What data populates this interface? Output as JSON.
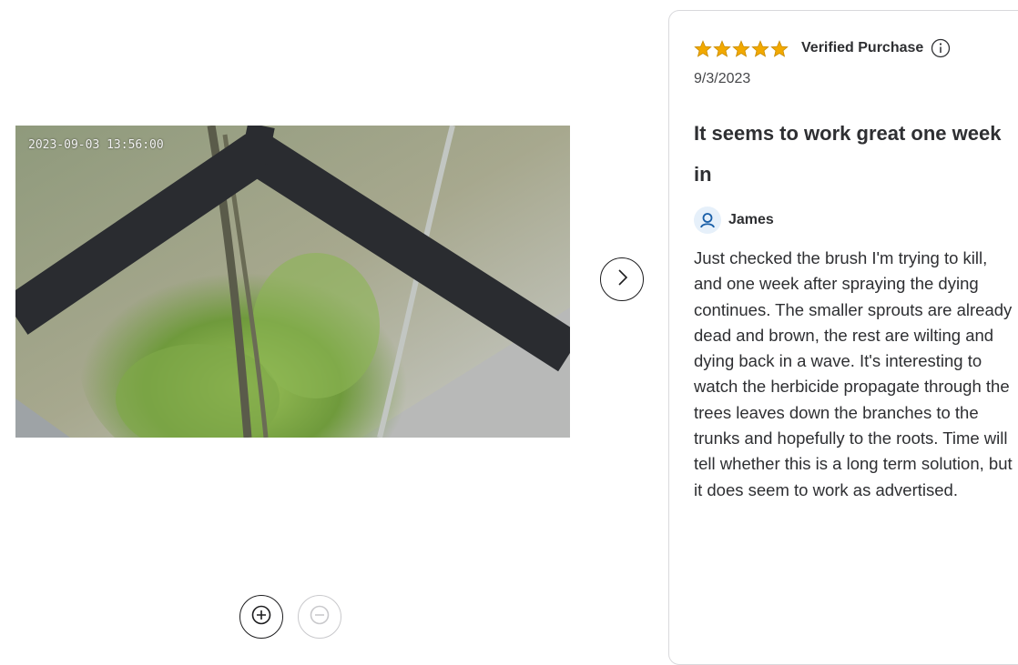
{
  "media": {
    "timestamp": "2023-09-03 13:56:00",
    "image_description_icon": "photo"
  },
  "navigation": {
    "next_icon": "chevron-right-icon",
    "zoom_in_icon": "zoom-in-icon",
    "zoom_out_icon": "zoom-out-icon"
  },
  "review": {
    "rating": 5,
    "rating_max": 5,
    "verified_label": "Verified Purchase",
    "date": "9/3/2023",
    "title": "It seems to work great one week in",
    "author": "James",
    "body": "Just checked the brush I'm trying to kill, and one week after spraying the dying continues. The smaller sprouts are already dead and brown, the rest are wilting and dying back in a wave. It's interesting to watch the herbicide propagate through the trees leaves down the branches to the trunks and hopefully to the roots. Time will tell whether this is a long term solution, but it does seem to work as advertised."
  },
  "colors": {
    "star": "#f2a900",
    "author_icon_bg": "#e6f0fa",
    "author_icon": "#1a5fa8",
    "text": "#2e2f32"
  }
}
